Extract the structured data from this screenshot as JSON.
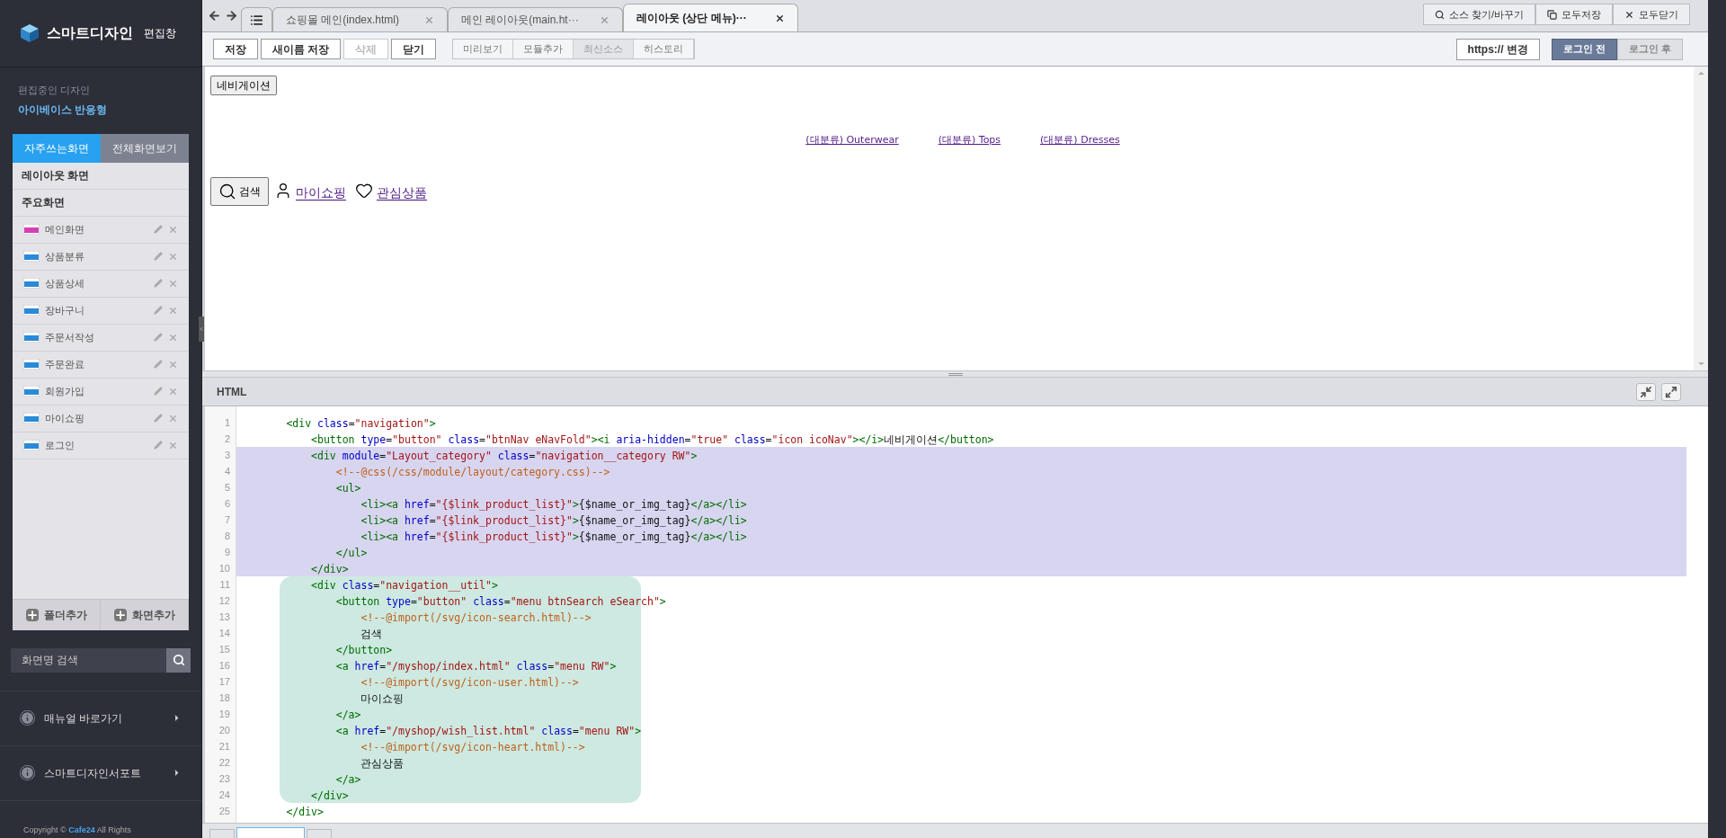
{
  "sidebar": {
    "logo": "스마트디자인",
    "logo_sub": "편집창",
    "editing_label": "편집중인 디자인",
    "design_name": "아이베이스 반응형",
    "tabs": [
      {
        "label": "자주쓰는화면",
        "selected": true
      },
      {
        "label": "전체화면보기",
        "selected": false
      }
    ],
    "sections": [
      "레이아웃 화면",
      "주요화면"
    ],
    "items": [
      {
        "label": "메인화면",
        "kind": "main"
      },
      {
        "label": "상품분류",
        "kind": "htm"
      },
      {
        "label": "상품상세",
        "kind": "htm"
      },
      {
        "label": "장바구니",
        "kind": "htm"
      },
      {
        "label": "주문서작성",
        "kind": "htm"
      },
      {
        "label": "주문완료",
        "kind": "htm"
      },
      {
        "label": "회원가입",
        "kind": "htm"
      },
      {
        "label": "마이쇼핑",
        "kind": "htm"
      },
      {
        "label": "로그인",
        "kind": "htm"
      }
    ],
    "footer_buttons": [
      "폴더추가",
      "화면추가"
    ],
    "search": {
      "placeholder": "화면명 검색"
    },
    "links": [
      "매뉴얼 바로가기",
      "스마트디자인서포트"
    ],
    "copyright": {
      "prefix": "Copyright ©",
      "brand": "Cafe24",
      "suffix": "All Rights"
    }
  },
  "tabs": [
    {
      "label": "쇼핑몰 메인(index.html)",
      "selected": false
    },
    {
      "label": "메인 레이아웃(main.ht···",
      "selected": false
    },
    {
      "label": "레이아웃 (상단 메뉴)···",
      "selected": true
    }
  ],
  "top_actions": [
    "소스 찾기/바꾸기",
    "모두저장",
    "모두닫기"
  ],
  "toolbar": {
    "buttons": [
      {
        "label": "저장",
        "disabled": false
      },
      {
        "label": "새이름 저장",
        "disabled": false
      },
      {
        "label": "삭제",
        "disabled": true
      },
      {
        "label": "닫기",
        "disabled": false
      }
    ],
    "group": [
      {
        "label": "미리보기",
        "disabled": false
      },
      {
        "label": "모듈추가",
        "disabled": false
      },
      {
        "label": "최신소스",
        "disabled": true
      },
      {
        "label": "히스토리",
        "disabled": false
      }
    ],
    "https": "https:// 변경",
    "login": [
      {
        "label": "로그인 전",
        "selected": true
      },
      {
        "label": "로그인 후",
        "selected": false
      }
    ]
  },
  "bottom_tabs": [
    {
      "selected": false
    },
    {
      "selected": true
    },
    {
      "selected": false
    }
  ],
  "preview": {
    "nav_button": "네비게이션",
    "categories": [
      "(대분류) Outerwear",
      "(대분류) Tops",
      "(대분류) Dresses"
    ],
    "search_button": "검색",
    "links": [
      {
        "label": "마이쇼핑",
        "kind": "user"
      },
      {
        "label": "관심상품",
        "kind": "heart"
      }
    ]
  },
  "editor": {
    "title": "HTML",
    "lines": [
      {
        "number": "1",
        "segments": [
          {
            "kind": "tag",
            "text": "        <div"
          },
          {
            "kind": "attr",
            "text": " class"
          },
          {
            "kind": "txt",
            "text": "="
          },
          {
            "kind": "str",
            "text": "\"navigation\""
          },
          {
            "kind": "tag",
            "text": ">"
          }
        ]
      },
      {
        "number": "2",
        "segments": [
          {
            "kind": "tag",
            "text": "            <button"
          },
          {
            "kind": "attr",
            "text": " type"
          },
          {
            "kind": "txt",
            "text": "="
          },
          {
            "kind": "str",
            "text": "\"button\""
          },
          {
            "kind": "attr",
            "text": " class"
          },
          {
            "kind": "txt",
            "text": "="
          },
          {
            "kind": "str",
            "text": "\"btnNav eNavFold\""
          },
          {
            "kind": "tag",
            "text": "><i"
          },
          {
            "kind": "attr",
            "text": " aria-hidden"
          },
          {
            "kind": "txt",
            "text": "="
          },
          {
            "kind": "str",
            "text": "\"true\""
          },
          {
            "kind": "attr",
            "text": " class"
          },
          {
            "kind": "txt",
            "text": "="
          },
          {
            "kind": "str",
            "text": "\"icon icoNav\""
          },
          {
            "kind": "tag",
            "text": "></i>"
          },
          {
            "kind": "txt",
            "text": "네비게이션"
          },
          {
            "kind": "tag",
            "text": "</button>"
          }
        ]
      },
      {
        "number": "3",
        "selected": true,
        "segments": [
          {
            "kind": "tag",
            "text": "            <div"
          },
          {
            "kind": "attr",
            "text": " module"
          },
          {
            "kind": "txt",
            "text": "="
          },
          {
            "kind": "str",
            "text": "\"Layout_category\""
          },
          {
            "kind": "attr",
            "text": " class"
          },
          {
            "kind": "txt",
            "text": "="
          },
          {
            "kind": "str",
            "text": "\"navigation__category RW\""
          },
          {
            "kind": "tag",
            "text": ">"
          }
        ]
      },
      {
        "number": "4",
        "selected": true,
        "segments": [
          {
            "kind": "cm",
            "text": "                <!--@css(/css/module/layout/category.css)-->"
          }
        ]
      },
      {
        "number": "5",
        "selected": true,
        "segments": [
          {
            "kind": "tag",
            "text": "                <ul>"
          }
        ]
      },
      {
        "number": "6",
        "selected": true,
        "segments": [
          {
            "kind": "tag",
            "text": "                    <li><a"
          },
          {
            "kind": "attr",
            "text": " href"
          },
          {
            "kind": "txt",
            "text": "="
          },
          {
            "kind": "str",
            "text": "\"{$link_product_list}\""
          },
          {
            "kind": "tag",
            "text": ">"
          },
          {
            "kind": "txt",
            "text": "{$name_or_img_tag}"
          },
          {
            "kind": "tag",
            "text": "</a></li>"
          }
        ]
      },
      {
        "number": "7",
        "selected": true,
        "segments": [
          {
            "kind": "tag",
            "text": "                    <li><a"
          },
          {
            "kind": "attr",
            "text": " href"
          },
          {
            "kind": "txt",
            "text": "="
          },
          {
            "kind": "str",
            "text": "\"{$link_product_list}\""
          },
          {
            "kind": "tag",
            "text": ">"
          },
          {
            "kind": "txt",
            "text": "{$name_or_img_tag}"
          },
          {
            "kind": "tag",
            "text": "</a></li>"
          }
        ]
      },
      {
        "number": "8",
        "selected": true,
        "segments": [
          {
            "kind": "tag",
            "text": "                    <li><a"
          },
          {
            "kind": "attr",
            "text": " href"
          },
          {
            "kind": "txt",
            "text": "="
          },
          {
            "kind": "str",
            "text": "\"{$link_product_list}\""
          },
          {
            "kind": "tag",
            "text": ">"
          },
          {
            "kind": "txt",
            "text": "{$name_or_img_tag}"
          },
          {
            "kind": "tag",
            "text": "</a></li>"
          }
        ]
      },
      {
        "number": "9",
        "selected": true,
        "segments": [
          {
            "kind": "tag",
            "text": "                </ul>"
          }
        ]
      },
      {
        "number": "10",
        "selected": true,
        "segments": [
          {
            "kind": "tag",
            "text": "            </div>"
          }
        ]
      },
      {
        "number": "11",
        "matched": true,
        "segments": [
          {
            "kind": "tag",
            "text": "            <div"
          },
          {
            "kind": "attr",
            "text": " class"
          },
          {
            "kind": "txt",
            "text": "="
          },
          {
            "kind": "str",
            "text": "\"navigation__util\""
          },
          {
            "kind": "tag",
            "text": ">"
          }
        ]
      },
      {
        "number": "12",
        "matched": true,
        "segments": [
          {
            "kind": "tag",
            "text": "                <button"
          },
          {
            "kind": "attr",
            "text": " type"
          },
          {
            "kind": "txt",
            "text": "="
          },
          {
            "kind": "str",
            "text": "\"button\""
          },
          {
            "kind": "attr",
            "text": " class"
          },
          {
            "kind": "txt",
            "text": "="
          },
          {
            "kind": "str",
            "text": "\"menu btnSearch eSearch\""
          },
          {
            "kind": "tag",
            "text": ">"
          }
        ]
      },
      {
        "number": "13",
        "matched": true,
        "segments": [
          {
            "kind": "cm",
            "text": "                    <!--@import(/svg/icon-search.html)-->"
          }
        ]
      },
      {
        "number": "14",
        "matched": true,
        "segments": [
          {
            "kind": "txt",
            "text": "                    검색"
          }
        ]
      },
      {
        "number": "15",
        "matched": true,
        "segments": [
          {
            "kind": "tag",
            "text": "                </button>"
          }
        ]
      },
      {
        "number": "16",
        "matched": true,
        "segments": [
          {
            "kind": "tag",
            "text": "                <a"
          },
          {
            "kind": "attr",
            "text": " href"
          },
          {
            "kind": "txt",
            "text": "="
          },
          {
            "kind": "str",
            "text": "\"/myshop/index.html\""
          },
          {
            "kind": "attr",
            "text": " class"
          },
          {
            "kind": "txt",
            "text": "="
          },
          {
            "kind": "str",
            "text": "\"menu RW\""
          },
          {
            "kind": "tag",
            "text": ">"
          }
        ]
      },
      {
        "number": "17",
        "matched": true,
        "segments": [
          {
            "kind": "cm",
            "text": "                    <!--@import(/svg/icon-user.html)-->"
          }
        ]
      },
      {
        "number": "18",
        "matched": true,
        "segments": [
          {
            "kind": "txt",
            "text": "                    마이쇼핑"
          }
        ]
      },
      {
        "number": "19",
        "matched": true,
        "segments": [
          {
            "kind": "tag",
            "text": "                </a>"
          }
        ]
      },
      {
        "number": "20",
        "matched": true,
        "segments": [
          {
            "kind": "tag",
            "text": "                <a"
          },
          {
            "kind": "attr",
            "text": " href"
          },
          {
            "kind": "txt",
            "text": "="
          },
          {
            "kind": "str",
            "text": "\"/myshop/wish_list.html\""
          },
          {
            "kind": "attr",
            "text": " class"
          },
          {
            "kind": "txt",
            "text": "="
          },
          {
            "kind": "str",
            "text": "\"menu RW\""
          },
          {
            "kind": "tag",
            "text": ">"
          }
        ]
      },
      {
        "number": "21",
        "matched": true,
        "segments": [
          {
            "kind": "cm",
            "text": "                    <!--@import(/svg/icon-heart.html)-->"
          }
        ]
      },
      {
        "number": "22",
        "matched": true,
        "segments": [
          {
            "kind": "txt",
            "text": "                    관심상품"
          }
        ]
      },
      {
        "number": "23",
        "matched": true,
        "segments": [
          {
            "kind": "tag",
            "text": "                </a>"
          }
        ]
      },
      {
        "number": "24",
        "matched": true,
        "segments": [
          {
            "kind": "tag",
            "text": "            </div>"
          }
        ]
      },
      {
        "number": "25",
        "segments": [
          {
            "kind": "tag",
            "text": "        </div>"
          }
        ]
      }
    ]
  }
}
